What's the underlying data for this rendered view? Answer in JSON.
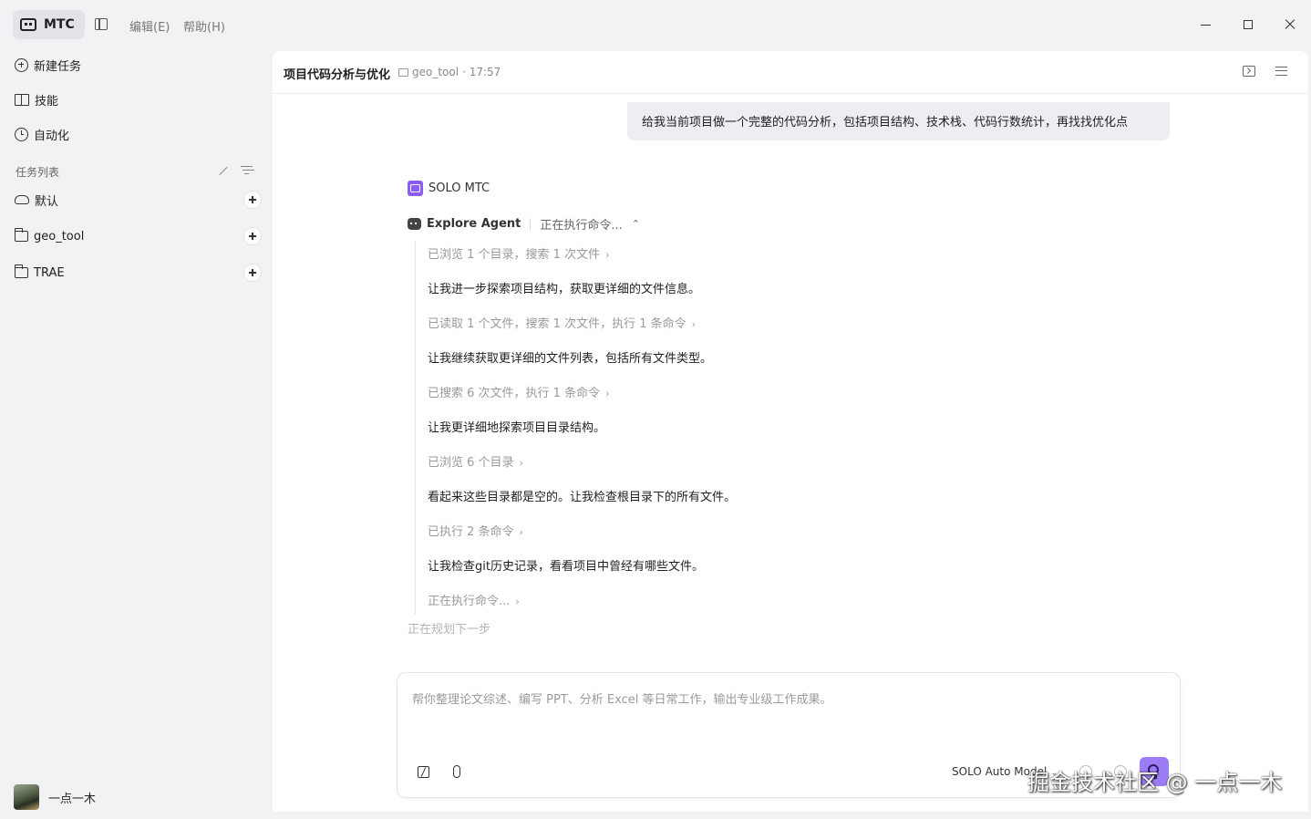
{
  "titlebar": {
    "brand": "MTC",
    "menus": [
      "编辑(E)",
      "帮助(H)"
    ]
  },
  "sidebar": {
    "nav": [
      {
        "label": "新建任务",
        "icon": "new-task-icon"
      },
      {
        "label": "技能",
        "icon": "skills-book-icon"
      },
      {
        "label": "自动化",
        "icon": "automation-clock-icon"
      }
    ],
    "section_title": "任务列表",
    "groups": [
      {
        "label": "默认",
        "icon": "cloud-icon"
      },
      {
        "label": "geo_tool",
        "icon": "folder-icon"
      },
      {
        "label": "TRAE",
        "icon": "folder-icon"
      }
    ],
    "user_name": "一点一木"
  },
  "header": {
    "title": "项目代码分析与优化",
    "folder": "geo_tool",
    "time": "· 17:57"
  },
  "chat": {
    "user_message": "给我当前项目做一个完整的代码分析，包括项目结构、技术栈、代码行数统计，再找找优化点",
    "agent_label": "SOLO MTC",
    "explore_name": "Explore Agent",
    "explore_status": "正在执行命令...",
    "steps": [
      {
        "text": "已浏览 1 个目录，搜索 1 次文件",
        "kind": "dim"
      },
      {
        "text": "让我进一步探索项目结构，获取更详细的文件信息。",
        "kind": "msg"
      },
      {
        "text": "已读取 1 个文件，搜索 1 次文件，执行 1 条命令",
        "kind": "dim"
      },
      {
        "text": "让我继续获取更详细的文件列表，包括所有文件类型。",
        "kind": "msg"
      },
      {
        "text": "已搜索 6 次文件，执行 1 条命令",
        "kind": "dim"
      },
      {
        "text": "让我更详细地探索项目目录结构。",
        "kind": "msg"
      },
      {
        "text": "已浏览 6 个目录",
        "kind": "dim"
      },
      {
        "text": "看起来这些目录都是空的。让我检查根目录下的所有文件。",
        "kind": "msg"
      },
      {
        "text": "已执行 2 条命令",
        "kind": "dim"
      },
      {
        "text": "让我检查git历史记录，看看项目中曾经有哪些文件。",
        "kind": "msg"
      },
      {
        "text": "正在执行命令...",
        "kind": "dim"
      }
    ],
    "planning": "正在规划下一步"
  },
  "composer": {
    "placeholder": "帮你整理论文综述、编写 PPT、分析 Excel 等日常工作，输出专业级工作成果。",
    "model": "SOLO Auto Model"
  },
  "watermark": "掘金技术社区 @ 一点一木",
  "colors": {
    "accent": "#8b5cf6",
    "send_button": "#9b7cf4",
    "background": "#f2f2f4",
    "panel": "#ffffff"
  }
}
